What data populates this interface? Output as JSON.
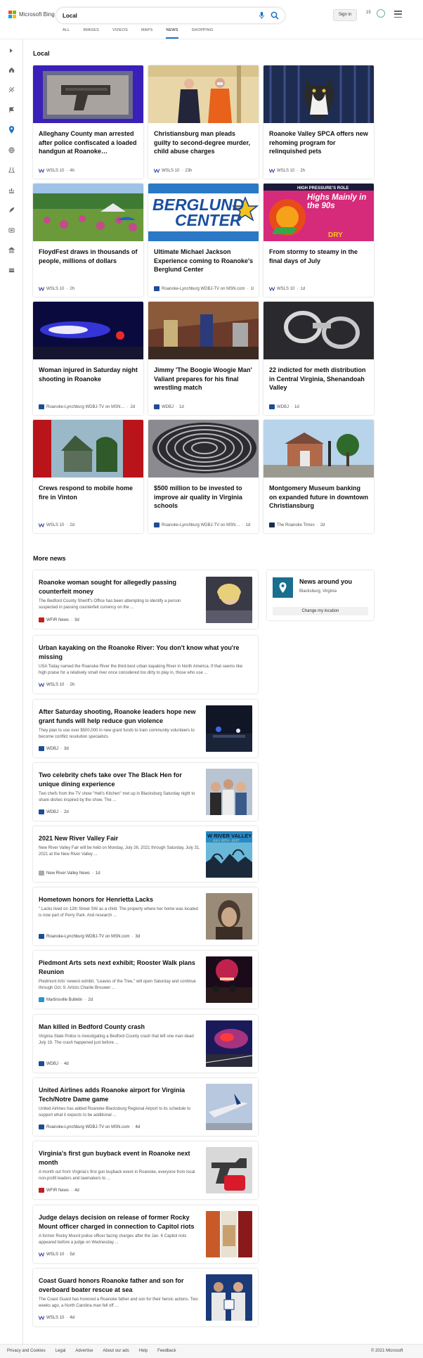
{
  "header": {
    "logo_text": "Microsoft Bing",
    "search_value": "Local",
    "sign_in": "Sign in",
    "points": "15"
  },
  "tabs": [
    "ALL",
    "IMAGES",
    "VIDEOS",
    "MAPS",
    "NEWS",
    "SHOPPING"
  ],
  "active_tab": "NEWS",
  "sidebar_icons": [
    "expand-icon",
    "home-icon",
    "sports-icon",
    "flag-icon",
    "location-icon",
    "globe-icon",
    "science-icon",
    "money-icon",
    "rocket-icon",
    "tv-icon",
    "politics-icon",
    "card-icon"
  ],
  "local": {
    "title": "Local",
    "cards": [
      {
        "title": "Alleghany County man arrested after police confiscated a loaded handgun at Roanoke…",
        "source": "WSLS 10",
        "age": "4h",
        "fav": "wsls"
      },
      {
        "title": "Christiansburg man pleads guilty to second-degree murder, child abuse charges",
        "source": "WSLS 10",
        "age": "23h",
        "fav": "wsls"
      },
      {
        "title": "Roanoke Valley SPCA offers new rehoming program for relinquished pets",
        "source": "WSLS 10",
        "age": "2h",
        "fav": "wsls"
      },
      {
        "title": "FloydFest draws in thousands of people, millions of dollars",
        "source": "WSLS 10",
        "age": "2h",
        "fav": "wsls"
      },
      {
        "title": "Ultimate Michael Jackson Experience coming to Roanoke's Berglund Center",
        "source": "Roanoke-Lynchburg WDBJ-TV on MSN.com",
        "age": "10h",
        "fav": "wdbj"
      },
      {
        "title": "From stormy to steamy in the final days of July",
        "source": "WSLS 10",
        "age": "1d",
        "fav": "wsls"
      },
      {
        "title": "Woman injured in Saturday night shooting in Roanoke",
        "source": "Roanoke-Lynchburg WDBJ-TV on MSN…",
        "age": "2d",
        "fav": "wdbj"
      },
      {
        "title": "Jimmy 'The Boogie Woogie Man' Valiant prepares for his final wrestling match",
        "source": "WDBJ",
        "age": "1d",
        "fav": "wdbj"
      },
      {
        "title": "22 indicted for meth distribution in Central Virginia, Shenandoah Valley",
        "source": "WDBJ",
        "age": "1d",
        "fav": "wdbj"
      },
      {
        "title": "Crews respond to mobile home fire in Vinton",
        "source": "WSLS 10",
        "age": "2d",
        "fav": "wsls"
      },
      {
        "title": "$500 million to be invested to improve air quality in Virginia schools",
        "source": "Roanoke-Lynchburg WDBJ-TV on MSN…",
        "age": "1d",
        "fav": "wdbj"
      },
      {
        "title": "Montgomery Museum banking on expanded future in downtown Christiansburg",
        "source": "The Roanoke Times",
        "age": "2d",
        "fav": "rt"
      }
    ],
    "image_text": {
      "berglund_line1": "BERGLUND",
      "berglund_line2": "CENTER",
      "weather_banner": "HIGH PRESSURE'S ROLE",
      "weather_text": "Highs Mainly in the 90s",
      "weather_tag": "DRY",
      "fair_text": "W RIVER VALLEY F",
      "fair_dates": "JULY 26TH - 31ST"
    }
  },
  "more_news": {
    "title": "More news",
    "items": [
      {
        "title": "Roanoke woman sought for allegedly passing counterfeit money",
        "snippet": "The Bedford County Sheriff's Office has been attempting to identify a person suspected in passing counterfeit currency on the ...",
        "source": "WFIR News",
        "age": "3d",
        "fav": "wfir"
      },
      {
        "title": "Urban kayaking on the Roanoke River: You don't know what you're missing",
        "snippet": "USA Today named the Roanoke River the third-best urban kayaking River in North America. If that seems like high praise for a relatively small river once considered too dirty to play in, those who use ...",
        "source": "WSLS 10",
        "age": "2h",
        "fav": "wsls"
      },
      {
        "title": "After Saturday shooting, Roanoke leaders hope new grant funds will help reduce gun violence",
        "snippet": "They plan to use over $500,000 in new grant funds to train community volunteers to become conflict resolution specialists.",
        "source": "WDBJ",
        "age": "3d",
        "fav": "wdbj"
      },
      {
        "title": "Two celebrity chefs take over The Black Hen for unique dining experience",
        "snippet": "Two chefs from the TV show \"Hell's Kitchen\" met up in Blacksburg Saturday night to share dishes inspired by the show. The ...",
        "source": "WDBJ",
        "age": "2d",
        "fav": "wdbj"
      },
      {
        "title": "2021 New River Valley Fair",
        "snippet": "New River Valley Fair will be held on Monday, July 26, 2021 through Saturday, July 31, 2021 at the New River Valley ...",
        "source": "New River Valley News",
        "age": "1d",
        "fav": "nrv"
      },
      {
        "title": "Hometown honors for Henrietta Lacks",
        "snippet": "\" Lacks lived on 12th Street SW as a child. The property where her home was located is now part of Perry Park. And research ...",
        "source": "Roanoke-Lynchburg WDBJ-TV on MSN.com",
        "age": "3d",
        "fav": "wdbj"
      },
      {
        "title": "Piedmont Arts sets next exhibit; Rooster Walk plans Reunion",
        "snippet": "Piedmont Arts' newest exhibit, \"Leaves of the Tree,\" will open Saturday and continue through Oct. 9. Artists Charlie Brouwer ...",
        "source": "Martinsville Bulletin",
        "age": "2d",
        "fav": "mb"
      },
      {
        "title": "Man killed in Bedford County crash",
        "snippet": "Virginia State Police is investigating a Bedford County crash that left one man dead July 19. The crash happened just before ...",
        "source": "WDBJ",
        "age": "4d",
        "fav": "wdbj"
      },
      {
        "title": "United Airlines adds Roanoke airport for Virginia Tech/Notre Dame game",
        "snippet": "United Airlines has added Roanoke Blacksburg Regional Airport to its schedule to support what it expects to be additional ...",
        "source": "Roanoke-Lynchburg WDBJ-TV on MSN.com",
        "age": "4d",
        "fav": "wdbj"
      },
      {
        "title": "Virginia's first gun buyback event in Roanoke next month",
        "snippet": "A month out from Virginia's first gun buyback event in Roanoke, everyone from local non-profit leaders and lawmakers to ...",
        "source": "WFIR News",
        "age": "4d",
        "fav": "wfir"
      },
      {
        "title": "Judge delays decision on release of former Rocky Mount officer charged in connection to Capitol riots",
        "snippet": "A former Rocky Mount police officer facing charges after the Jan. 6 Capitol riots appeared before a judge on Wednesday ...",
        "source": "WSLS 10",
        "age": "5d",
        "fav": "wsls"
      },
      {
        "title": "Coast Guard honors Roanoke father and son for overboard boater rescue at sea",
        "snippet": "The Coast Guard has honored a Roanoke father and son for their heroic actions. Two weeks ago, a North Carolina man fell off ...",
        "source": "WSLS 10",
        "age": "4d",
        "fav": "wsls"
      }
    ]
  },
  "news_around": {
    "title": "News around you",
    "location": "Blacksburg, Virginia",
    "button": "Change my location"
  },
  "footer": {
    "links": [
      "Privacy and Cookies",
      "Legal",
      "Advertise",
      "About our ads",
      "Help",
      "Feedback"
    ],
    "copyright": "© 2021 Microsoft"
  }
}
